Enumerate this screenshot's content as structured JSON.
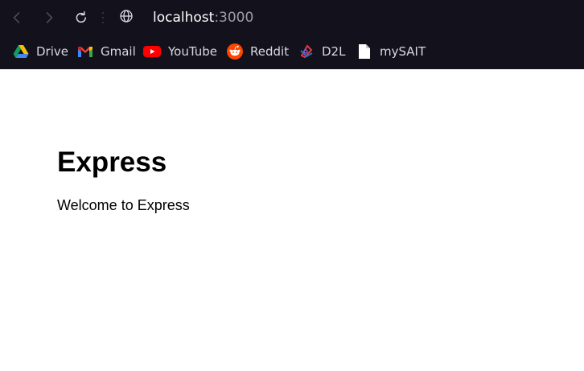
{
  "browser": {
    "address_bar": {
      "host": "localhost",
      "port": ":3000"
    },
    "nav_icons": [
      "back-icon",
      "forward-icon",
      "reload-icon",
      "globe-icon"
    ],
    "bookmarks": [
      {
        "label": "Drive",
        "icon": "google-drive-icon"
      },
      {
        "label": "Gmail",
        "icon": "gmail-icon"
      },
      {
        "label": "YouTube",
        "icon": "youtube-icon"
      },
      {
        "label": "Reddit",
        "icon": "reddit-icon"
      },
      {
        "label": "D2L",
        "icon": "d2l-icon"
      },
      {
        "label": "mySAIT",
        "icon": "document-icon"
      }
    ]
  },
  "page": {
    "heading": "Express",
    "body_text": "Welcome to Express"
  },
  "colors": {
    "chrome_background": "#12111c",
    "page_background": "#ffffff",
    "bookmark_text": "#d9d8e2",
    "url_host": "#ffffff",
    "url_port": "#9d9ca8"
  }
}
